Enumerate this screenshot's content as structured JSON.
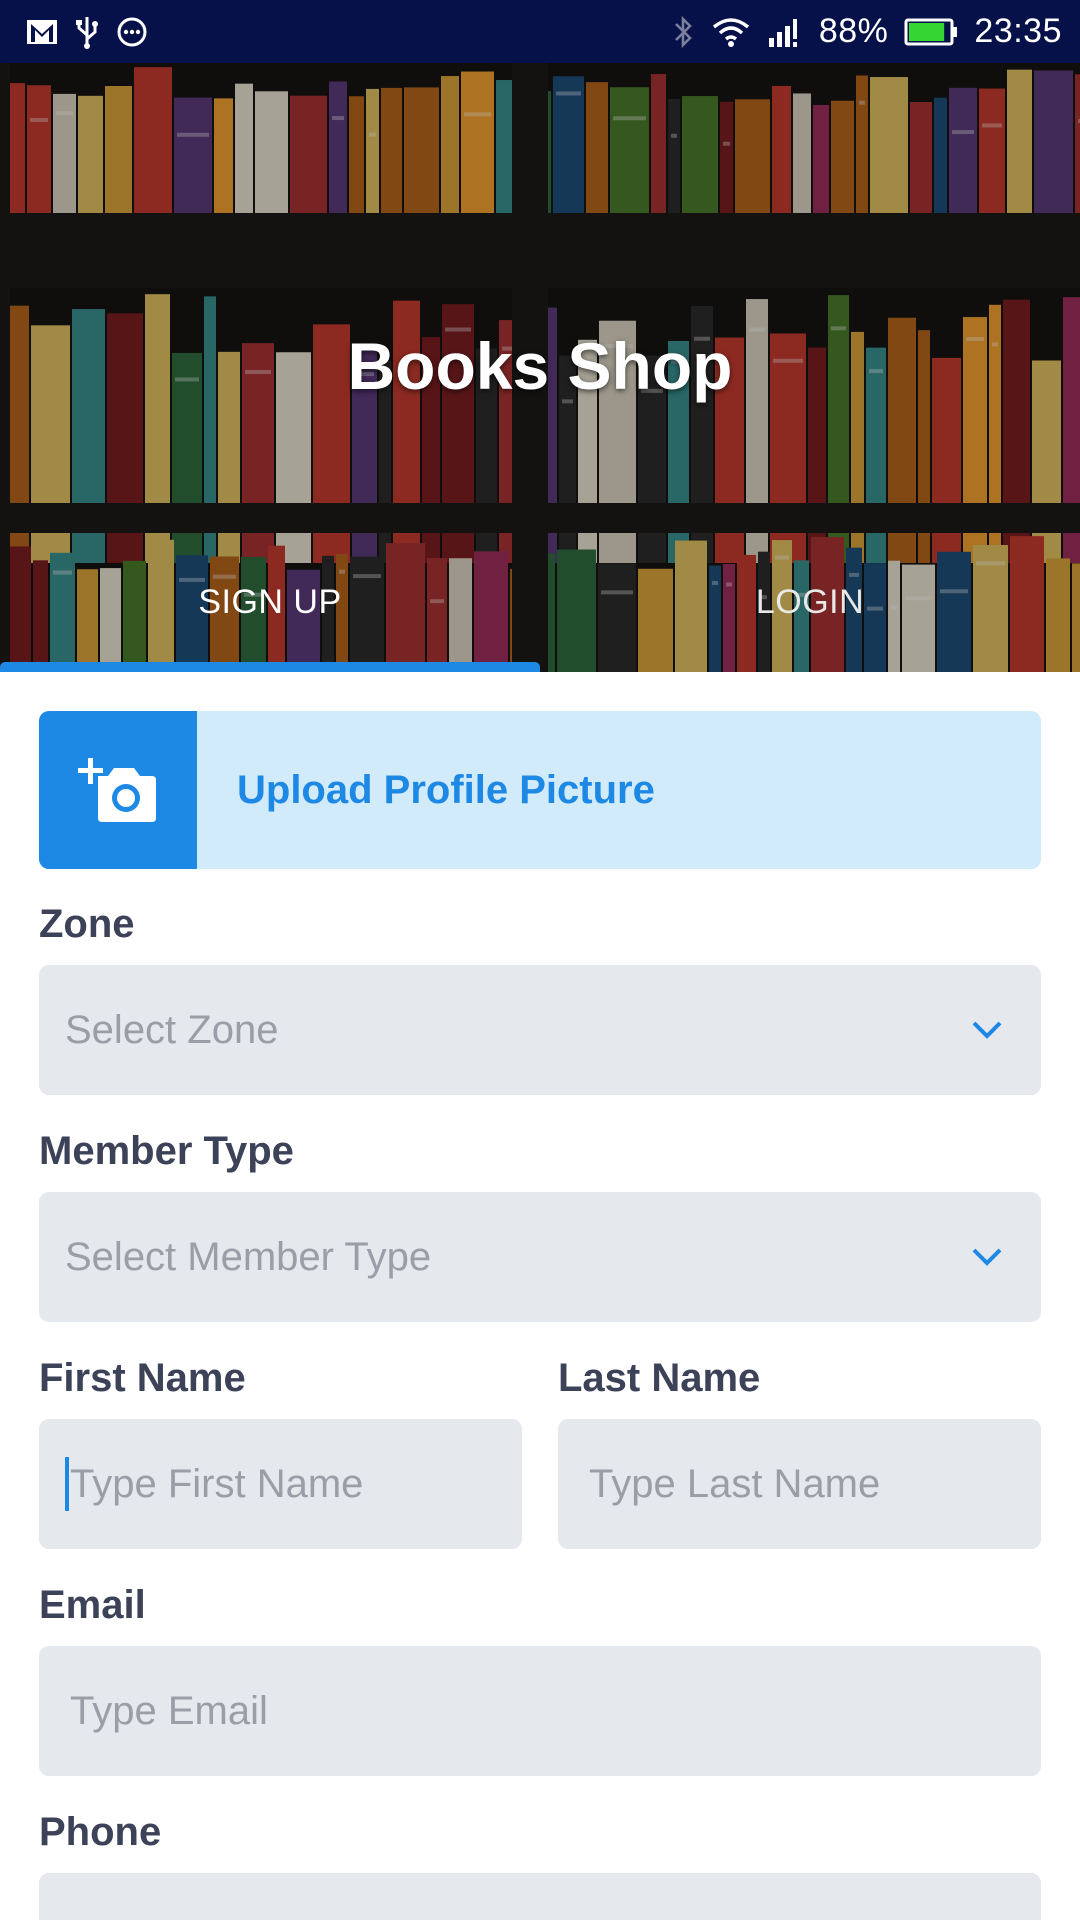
{
  "status_bar": {
    "icons_left": [
      "gmail-icon",
      "usb-icon",
      "more-icon"
    ],
    "icons_right": [
      "bluetooth-icon",
      "wifi-icon",
      "signal-icon",
      "battery-icon"
    ],
    "battery": "88%",
    "time": "23:35",
    "battery_level": 0.88
  },
  "header": {
    "title": "Books Shop",
    "tabs": [
      {
        "label": "SIGN UP",
        "active": true
      },
      {
        "label": "LOGIN",
        "active": false
      }
    ],
    "accent": "#1e88e5"
  },
  "form": {
    "upload": {
      "label": "Upload Profile Picture",
      "icon": "add-photo-icon"
    },
    "zone": {
      "label": "Zone",
      "placeholder": "Select Zone"
    },
    "member_type": {
      "label": "Member Type",
      "placeholder": "Select Member Type"
    },
    "first_name": {
      "label": "First Name",
      "placeholder": "Type First Name"
    },
    "last_name": {
      "label": "Last Name",
      "placeholder": "Type Last Name"
    },
    "email": {
      "label": "Email",
      "placeholder": "Type Email"
    },
    "phone": {
      "label": "Phone",
      "placeholder": ""
    }
  },
  "colors": {
    "status_bar": "#061049",
    "accent": "#1e88e5",
    "upload_bg": "#d2ebfb",
    "field_bg": "#e5e8ec",
    "label": "#3c4257",
    "placeholder": "#9a9ea6"
  }
}
